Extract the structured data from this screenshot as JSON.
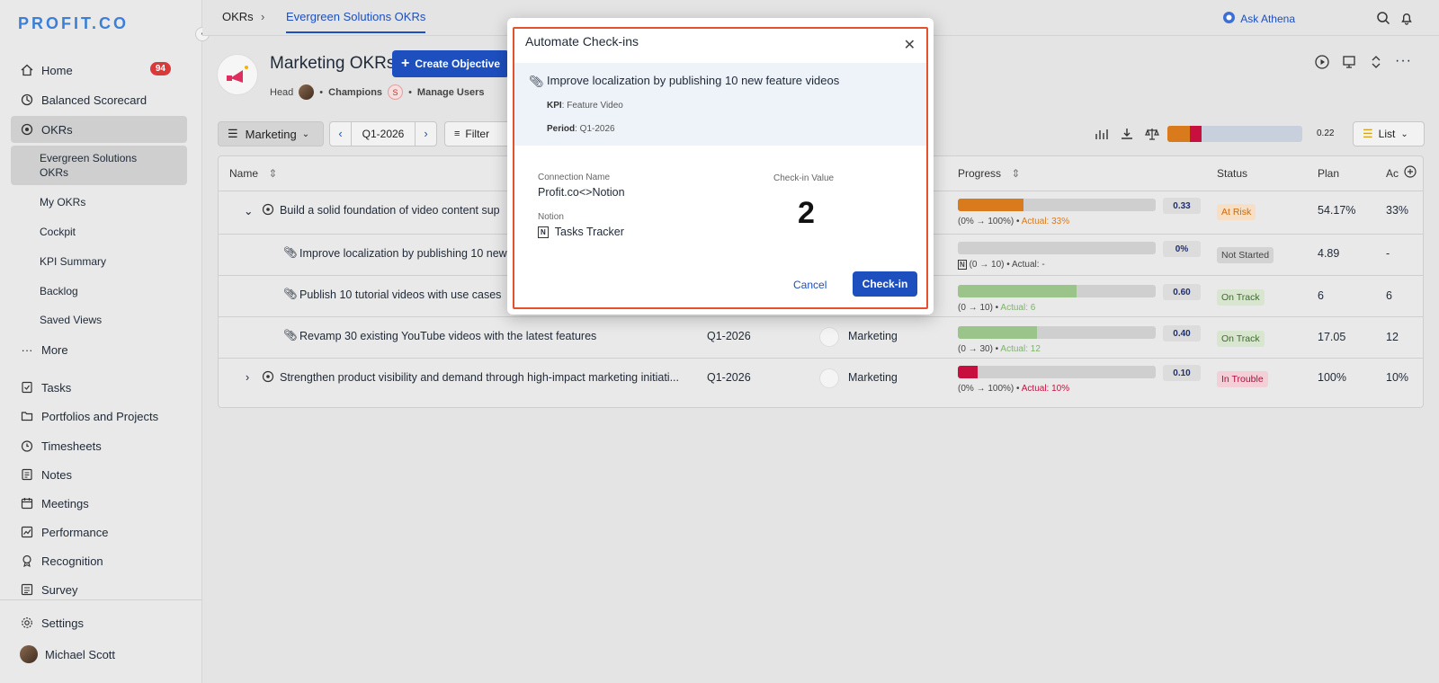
{
  "brand": "PROFIT.CO",
  "sidebar": {
    "home": "Home",
    "home_badge": "94",
    "balanced": "Balanced Scorecard",
    "okrs": "OKRs",
    "okr_subs": [
      "Evergreen Solutions OKRs",
      "My OKRs",
      "Cockpit",
      "KPI Summary",
      "Backlog",
      "Saved Views"
    ],
    "more": "More",
    "items": [
      "Tasks",
      "Portfolios and Projects",
      "Timesheets",
      "Notes",
      "Meetings",
      "Performance",
      "Recognition",
      "Survey"
    ],
    "settings": "Settings",
    "user": "Michael Scott"
  },
  "topbar": {
    "crumb1": "OKRs",
    "crumb2": "Evergreen Solutions OKRs",
    "ask": "Ask Athena"
  },
  "header": {
    "title": "Marketing OKRs",
    "create": "Create Objective",
    "head": "Head",
    "champions": "Champions",
    "champ_initial": "S",
    "manage": "Manage Users"
  },
  "toolbar": {
    "team": "Marketing",
    "period": "Q1-2026",
    "filter": "Filter",
    "score": "0.22",
    "view": "List"
  },
  "table": {
    "headers": {
      "name": "Name",
      "progress": "Progress",
      "status": "Status",
      "plan": "Plan",
      "actual": "Ac"
    },
    "rows": [
      {
        "name": "Build a solid foundation of video content sup",
        "period": "",
        "team": "",
        "progress": "0.33",
        "range": "(0% → 100%)",
        "actual": "Actual: 33%",
        "status": "At Risk",
        "plan": "54.17%",
        "act": "33%"
      },
      {
        "name": "Improve localization by publishing 10 new",
        "period": "",
        "team": "",
        "progress": "0%",
        "range": "(0 → 10)",
        "actual": "Actual: -",
        "status": "Not Started",
        "plan": "4.89",
        "act": "-"
      },
      {
        "name": "Publish 10 tutorial videos with use cases",
        "period": "",
        "team": "",
        "progress": "0.60",
        "range": "(0 → 10)",
        "actual": "Actual: 6",
        "status": "On Track",
        "plan": "6",
        "act": "6"
      },
      {
        "name": "Revamp 30 existing YouTube videos with the latest features",
        "period": "Q1-2026",
        "team": "Marketing",
        "progress": "0.40",
        "range": "(0 → 30)",
        "actual": "Actual: 12",
        "status": "On Track",
        "plan": "17.05",
        "act": "12"
      },
      {
        "name": "Strengthen product visibility and demand through high-impact marketing initiati...",
        "period": "Q1-2026",
        "team": "Marketing",
        "progress": "0.10",
        "range": "(0% → 100%)",
        "actual": "Actual: 10%",
        "status": "In Trouble",
        "plan": "100%",
        "act": "10%"
      }
    ]
  },
  "modal": {
    "title": "Automate Check-ins",
    "kr_title": "Improve localization by publishing 10 new feature videos",
    "kpi_label": "KPI",
    "kpi_value": ": Feature Video",
    "period_label": "Period",
    "period_value": ": Q1-2026",
    "conn_label": "Connection Name",
    "conn_value": "Profit.co<>Notion",
    "notion_label": "Notion",
    "notion_value": "Tasks Tracker",
    "checkin_label": "Check-in Value",
    "checkin_value": "2",
    "cancel": "Cancel",
    "submit": "Check-in"
  }
}
